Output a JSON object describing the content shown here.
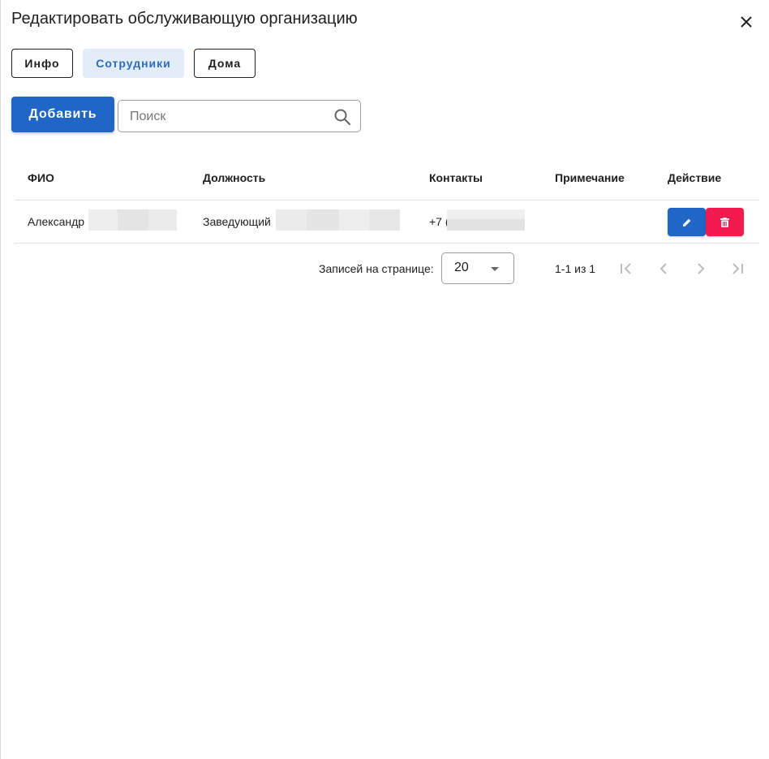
{
  "dialog": {
    "title": "Редактировать обслуживающую организацию",
    "close_icon": "close-icon"
  },
  "tabs": [
    {
      "label": "Инфо",
      "active": false
    },
    {
      "label": "Сотрудники",
      "active": true
    },
    {
      "label": "Дома",
      "active": false
    }
  ],
  "toolbar": {
    "add_label": "Добавить",
    "search_placeholder": "Поиск",
    "search_value": "",
    "search_icon": "search-icon"
  },
  "table": {
    "columns": [
      "ФИО",
      "Должность",
      "Контакты",
      "Примечание",
      "Действие"
    ],
    "rows": [
      {
        "name": "Александр",
        "position": "Заведующий",
        "contacts": "+7 (",
        "note": "",
        "actions": [
          "edit-icon",
          "delete-icon"
        ]
      }
    ]
  },
  "pagination": {
    "rows_per_page_label": "Записей на странице:",
    "rows_per_page_value": "20",
    "range_text": "1-1 из 1",
    "first_icon": "first-page-icon",
    "prev_icon": "chevron-left-icon",
    "next_icon": "chevron-right-icon",
    "last_icon": "last-page-icon"
  },
  "colors": {
    "primary": "#1f66c7",
    "danger": "#f21b50",
    "active_tab_bg": "#e3edf9",
    "active_tab_text": "#2f6bbd"
  }
}
